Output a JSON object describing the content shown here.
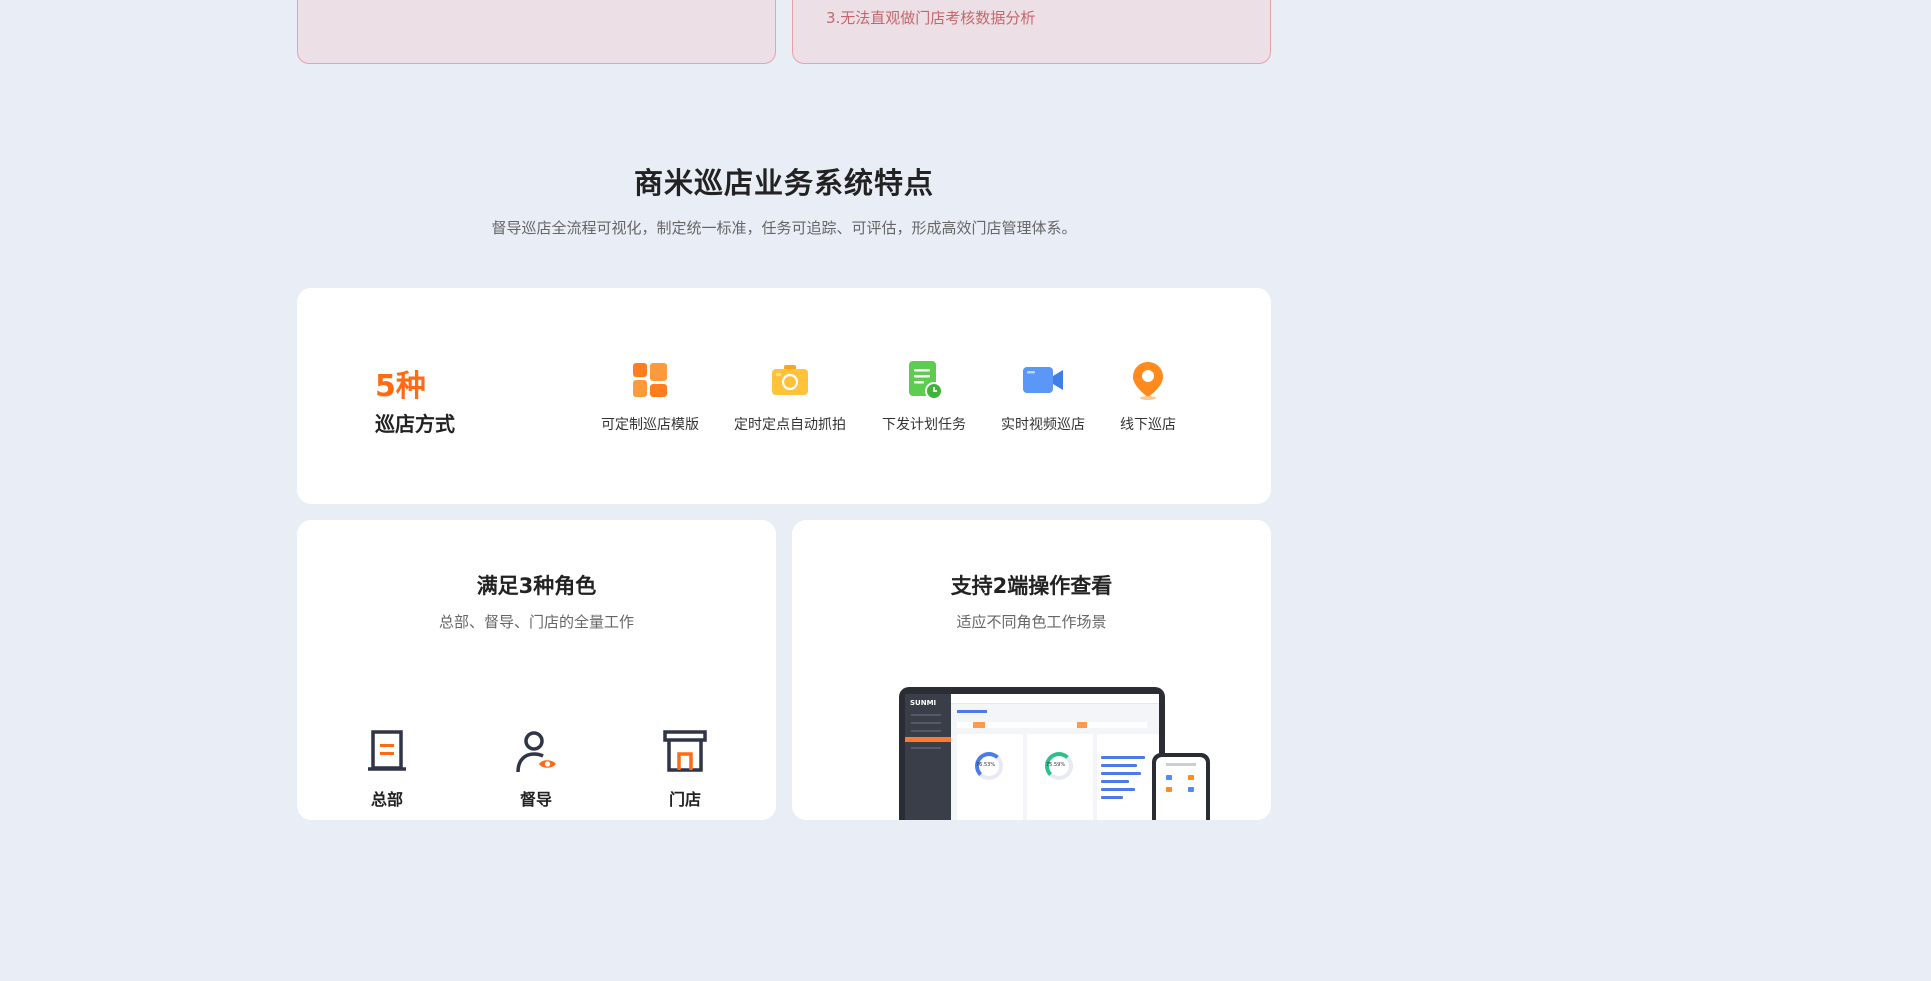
{
  "pain_points": {
    "right_line": "3.无法直观做门店考核数据分析"
  },
  "section": {
    "title": "商米巡店业务系统特点",
    "subtitle": "督导巡店全流程可视化，制定统一标准，任务可追踪、可评估，形成高效门店管理体系。"
  },
  "modes": {
    "count": "5种",
    "label": "巡店方式",
    "items": [
      {
        "label": "可定制巡店模版",
        "icon": "template-grid-icon",
        "color": "#ff7d1f"
      },
      {
        "label": "定时定点自动抓拍",
        "icon": "camera-icon",
        "color": "#ffb61e"
      },
      {
        "label": "下发计划任务",
        "icon": "task-document-clock-icon",
        "color": "#5ccd4e"
      },
      {
        "label": "实时视频巡店",
        "icon": "video-camera-icon",
        "color": "#4e8cf5"
      },
      {
        "label": "线下巡店",
        "icon": "location-pin-icon",
        "color": "#ff8a1e"
      }
    ]
  },
  "roles_card": {
    "title": "满足3种角色",
    "subtitle": "总部、督导、门店的全量工作",
    "roles": [
      {
        "label": "总部",
        "icon": "headquarters-icon"
      },
      {
        "label": "督导",
        "icon": "supervisor-icon"
      },
      {
        "label": "门店",
        "icon": "store-icon"
      }
    ]
  },
  "devices_card": {
    "title": "支持2端操作查看",
    "subtitle": "适应不同角色工作场景",
    "screen_logo": "SUNMI",
    "gauge_left": "76.53%",
    "gauge_right": "75.59%"
  },
  "colors": {
    "accent": "#ff6a13",
    "role_icon": "#2f3446",
    "role_accent": "#ff6a13"
  }
}
